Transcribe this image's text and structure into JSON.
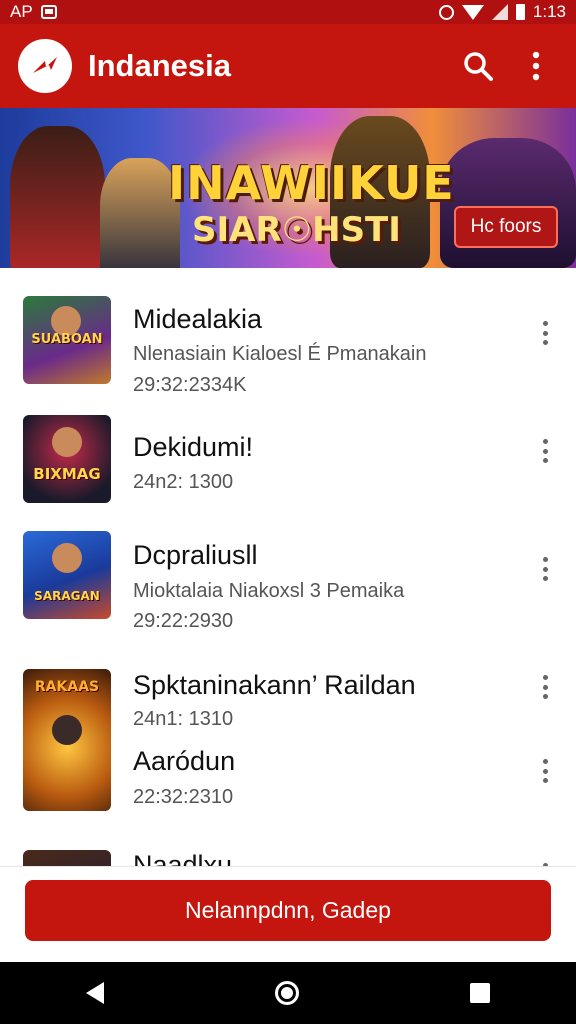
{
  "status_bar": {
    "left_text": "AP",
    "time": "1:13"
  },
  "app_bar": {
    "title": "Indanesia",
    "search_icon": "search-icon",
    "menu_icon": "more-vert-icon"
  },
  "banner": {
    "title": "INAWIIKUE",
    "subtitle": "SIAR☉HSTI",
    "button_label": "Hc foors"
  },
  "list": {
    "items": [
      {
        "title": "Midealakia",
        "subtitle": "Nlenasiain Kialoesl  É Pmanakain",
        "meta": "29:32:2334K",
        "thumb_label": "SUABOAN"
      },
      {
        "title": "Dekidumi!",
        "subtitle": "",
        "meta": "24n2: 1300",
        "thumb_label": "BIXMAG"
      },
      {
        "title": "Dcpraliusll",
        "subtitle": "Mioktalaia Niakoxsl  3 Pemaika",
        "meta": "29:22:2930",
        "thumb_label": "SARAGAN"
      },
      {
        "title": "Spktaninakann’ Raildan",
        "subtitle": "",
        "meta": "24n1: 1310",
        "thumb_label": "RAKAAS"
      },
      {
        "title": "Aaródun",
        "subtitle": "",
        "meta": "22:32:2310",
        "thumb_label": ""
      },
      {
        "title": "Naadlxu",
        "subtitle": "",
        "meta": "",
        "thumb_label": ""
      }
    ]
  },
  "primary_button": {
    "label": "Nelannpdnn, Gadep"
  },
  "colors": {
    "accent": "#c4150f",
    "status_bar": "#b01010",
    "nav_bar": "#000000"
  }
}
